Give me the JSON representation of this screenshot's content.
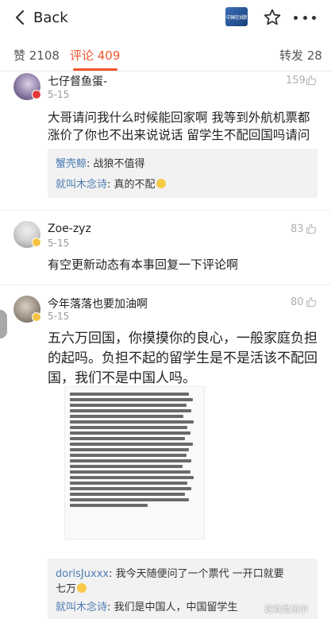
{
  "nav": {
    "back_label": "Back",
    "logo_text": "中国在线新闻"
  },
  "tabs": {
    "likes": "赞 2108",
    "comments": "评论 409",
    "reposts": "转发 28"
  },
  "comments": [
    {
      "username": "七仔督鱼蛋-",
      "date": "5-15",
      "likes": "159",
      "text": "大哥请问我什么时候能回家啊 我等到外航机票都涨价了你也不出来说说话 留学生不配回国吗请问",
      "replies": [
        {
          "name": "蟹壳鲸",
          "text": "战狼不值得"
        },
        {
          "name": "就叫木念诗",
          "text": "真的不配"
        }
      ]
    },
    {
      "username": "Zoe-zyz",
      "date": "5-15",
      "likes": "83",
      "text": "有空更新动态有本事回复一下评论啊"
    },
    {
      "username": "今年落落也要加油啊",
      "date": "5-15",
      "likes": "80",
      "text": "五六万回国，你摸摸你的良心，一般家庭负担的起吗。负担不起的留学生是不是活该不配回国，我们不是中国人吗。",
      "replies": [
        {
          "name": "dorisJuxxx",
          "text": "我今天随便问了一个票代 一开口就要",
          "text2": "七万"
        },
        {
          "name": "就叫木念诗",
          "text": "我们是中国人，中国留学生"
        }
      ]
    }
  ],
  "watermark": "这就是法尔"
}
